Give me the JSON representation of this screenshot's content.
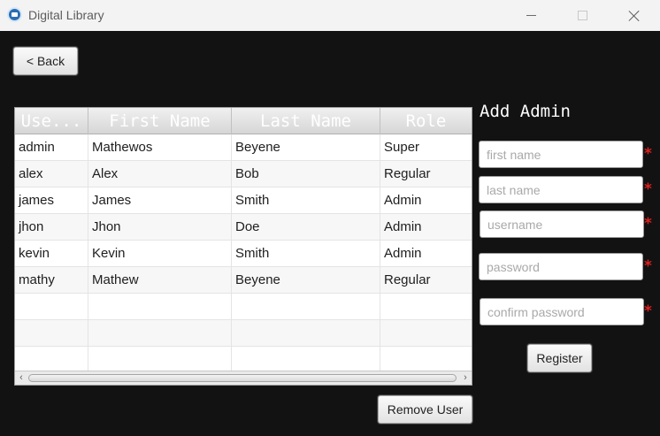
{
  "window": {
    "title": "Digital Library"
  },
  "nav": {
    "back_label": "< Back"
  },
  "table": {
    "columns": [
      "Use...",
      "First Name",
      "Last Name",
      "Role"
    ],
    "rows": [
      [
        "admin",
        "Mathewos",
        "Beyene",
        "Super"
      ],
      [
        "alex",
        "Alex",
        "Bob",
        "Regular"
      ],
      [
        "james",
        "James",
        "Smith",
        "Admin"
      ],
      [
        "jhon",
        "Jhon",
        "Doe",
        "Admin"
      ],
      [
        "kevin",
        "Kevin",
        "Smith",
        "Admin"
      ],
      [
        "mathy",
        "Mathew",
        "Beyene",
        "Regular"
      ]
    ],
    "remove_label": "Remove User"
  },
  "form": {
    "title": "Add Admin",
    "first_name_placeholder": "first name",
    "last_name_placeholder": "last name",
    "username_placeholder": "username",
    "password_placeholder": "password",
    "confirm_password_placeholder": "confirm password",
    "required_marker": "*",
    "register_label": "Register"
  },
  "colors": {
    "background": "#121212",
    "required": "#e02020"
  }
}
